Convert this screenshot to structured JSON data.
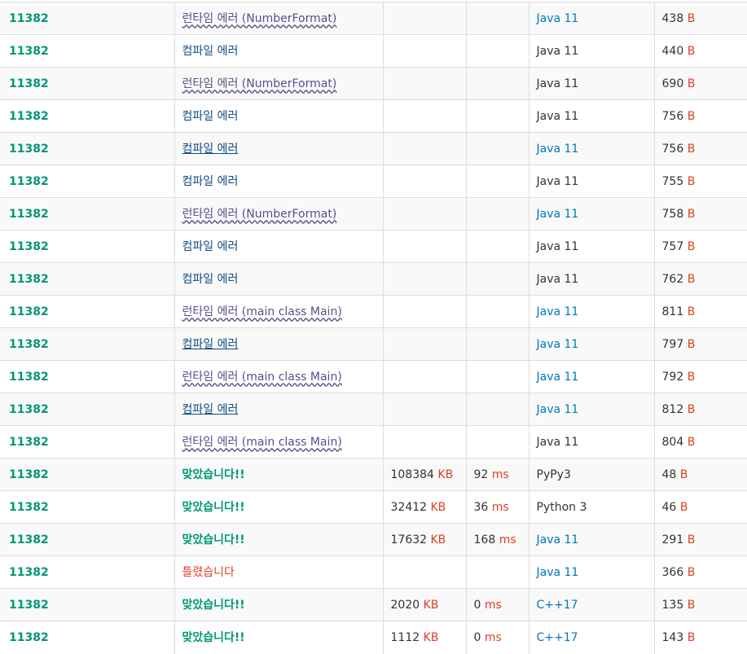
{
  "units": {
    "memory": "KB",
    "time": "ms",
    "code": "B"
  },
  "colors": {
    "accepted": "#009874",
    "wrong": "#dd4124",
    "compile_error": "#0f4c81",
    "runtime_error": "#5f4b8b",
    "language_link": "#0076c0",
    "unit": "#dd4124"
  },
  "rows": [
    {
      "problem": "11382",
      "result": "런타임 에러 (NumberFormat)",
      "result_type": "rte",
      "result_link": false,
      "memory": "",
      "time": "",
      "language": "Java 11",
      "language_link": true,
      "code_length": "438"
    },
    {
      "problem": "11382",
      "result": "컴파일 에러",
      "result_type": "ce",
      "result_link": false,
      "memory": "",
      "time": "",
      "language": "Java 11",
      "language_link": false,
      "code_length": "440"
    },
    {
      "problem": "11382",
      "result": "런타임 에러 (NumberFormat)",
      "result_type": "rte",
      "result_link": false,
      "memory": "",
      "time": "",
      "language": "Java 11",
      "language_link": false,
      "code_length": "690"
    },
    {
      "problem": "11382",
      "result": "컴파일 에러",
      "result_type": "ce",
      "result_link": false,
      "memory": "",
      "time": "",
      "language": "Java 11",
      "language_link": false,
      "code_length": "756"
    },
    {
      "problem": "11382",
      "result": "컴파일 에러",
      "result_type": "ce",
      "result_link": true,
      "memory": "",
      "time": "",
      "language": "Java 11",
      "language_link": true,
      "code_length": "756"
    },
    {
      "problem": "11382",
      "result": "컴파일 에러",
      "result_type": "ce",
      "result_link": false,
      "memory": "",
      "time": "",
      "language": "Java 11",
      "language_link": false,
      "code_length": "755"
    },
    {
      "problem": "11382",
      "result": "런타임 에러 (NumberFormat)",
      "result_type": "rte",
      "result_link": false,
      "memory": "",
      "time": "",
      "language": "Java 11",
      "language_link": true,
      "code_length": "758"
    },
    {
      "problem": "11382",
      "result": "컴파일 에러",
      "result_type": "ce",
      "result_link": false,
      "memory": "",
      "time": "",
      "language": "Java 11",
      "language_link": false,
      "code_length": "757"
    },
    {
      "problem": "11382",
      "result": "컴파일 에러",
      "result_type": "ce",
      "result_link": false,
      "memory": "",
      "time": "",
      "language": "Java 11",
      "language_link": false,
      "code_length": "762"
    },
    {
      "problem": "11382",
      "result": "런타임 에러 (main class Main)",
      "result_type": "rte",
      "result_link": false,
      "memory": "",
      "time": "",
      "language": "Java 11",
      "language_link": true,
      "code_length": "811"
    },
    {
      "problem": "11382",
      "result": "컴파일 에러",
      "result_type": "ce",
      "result_link": true,
      "memory": "",
      "time": "",
      "language": "Java 11",
      "language_link": true,
      "code_length": "797"
    },
    {
      "problem": "11382",
      "result": "런타임 에러 (main class Main)",
      "result_type": "rte",
      "result_link": false,
      "memory": "",
      "time": "",
      "language": "Java 11",
      "language_link": true,
      "code_length": "792"
    },
    {
      "problem": "11382",
      "result": "컴파일 에러",
      "result_type": "ce",
      "result_link": true,
      "memory": "",
      "time": "",
      "language": "Java 11",
      "language_link": true,
      "code_length": "812"
    },
    {
      "problem": "11382",
      "result": "런타임 에러 (main class Main)",
      "result_type": "rte",
      "result_link": false,
      "memory": "",
      "time": "",
      "language": "Java 11",
      "language_link": false,
      "code_length": "804"
    },
    {
      "problem": "11382",
      "result": "맞았습니다!!",
      "result_type": "ac",
      "result_link": false,
      "memory": "108384",
      "time": "92",
      "language": "PyPy3",
      "language_link": false,
      "code_length": "48"
    },
    {
      "problem": "11382",
      "result": "맞았습니다!!",
      "result_type": "ac",
      "result_link": false,
      "memory": "32412",
      "time": "36",
      "language": "Python 3",
      "language_link": false,
      "code_length": "46"
    },
    {
      "problem": "11382",
      "result": "맞았습니다!!",
      "result_type": "ac",
      "result_link": false,
      "memory": "17632",
      "time": "168",
      "language": "Java 11",
      "language_link": true,
      "code_length": "291"
    },
    {
      "problem": "11382",
      "result": "틀렸습니다",
      "result_type": "wa",
      "result_link": false,
      "memory": "",
      "time": "",
      "language": "Java 11",
      "language_link": true,
      "code_length": "366"
    },
    {
      "problem": "11382",
      "result": "맞았습니다!!",
      "result_type": "ac",
      "result_link": false,
      "memory": "2020",
      "time": "0",
      "language": "C++17",
      "language_link": true,
      "code_length": "135"
    },
    {
      "problem": "11382",
      "result": "맞았습니다!!",
      "result_type": "ac",
      "result_link": false,
      "memory": "1112",
      "time": "0",
      "language": "C++17",
      "language_link": true,
      "code_length": "143"
    }
  ]
}
